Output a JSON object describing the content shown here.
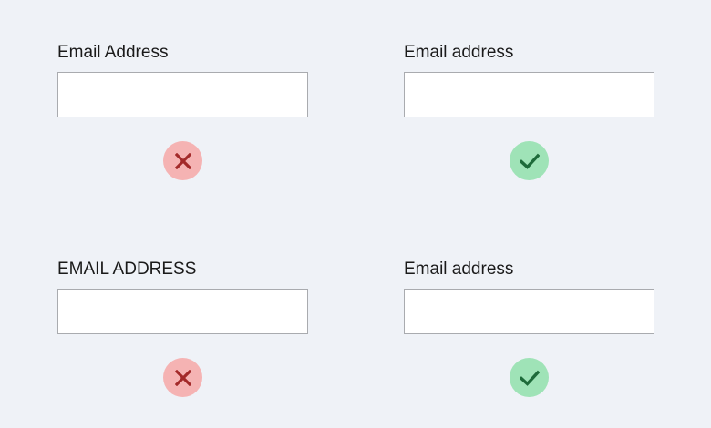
{
  "examples": [
    {
      "label": "Email Address",
      "input_value": "",
      "verdict": "incorrect",
      "icon": "cross-icon"
    },
    {
      "label": "Email address",
      "input_value": "",
      "verdict": "correct",
      "icon": "check-icon"
    },
    {
      "label": "EMAIL ADDRESS",
      "input_value": "",
      "verdict": "incorrect",
      "icon": "cross-icon"
    },
    {
      "label": "Email address",
      "input_value": "",
      "verdict": "correct",
      "icon": "check-icon"
    }
  ],
  "colors": {
    "background": "#eff2f7",
    "incorrect_badge": "#f5b3b3",
    "incorrect_mark": "#a32a2a",
    "correct_badge": "#9fe3b7",
    "correct_mark": "#1e6b3a",
    "input_border": "#a9abaf"
  }
}
